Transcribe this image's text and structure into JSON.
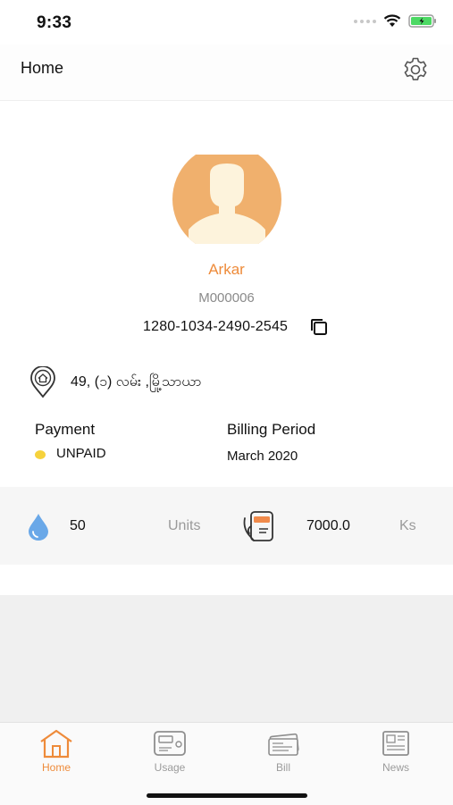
{
  "status_bar": {
    "time": "9:33"
  },
  "header": {
    "title": "Home",
    "settings_icon": "gear-icon"
  },
  "profile": {
    "name": "Arkar",
    "member_id": "M000006",
    "account_number": "1280-1034-2490-2545",
    "avatar_icon": "user-avatar-icon",
    "copy_icon": "copy-icon"
  },
  "address": {
    "icon": "home-location-pin-icon",
    "text": "49, (၁) လမ်း ,မြို့သာယာ"
  },
  "payment": {
    "label": "Payment",
    "status": "UNPAID",
    "status_color": "#f6d23c"
  },
  "billing": {
    "label": "Billing Period",
    "period": "March 2020"
  },
  "usage": {
    "units_value": "50",
    "units_label": "Units",
    "amount_value": "7000.0",
    "currency_label": "Ks"
  },
  "tabs": [
    {
      "label": "Home",
      "icon": "house-icon",
      "active": true
    },
    {
      "label": "Usage",
      "icon": "meter-icon",
      "active": false
    },
    {
      "label": "Bill",
      "icon": "bill-icon",
      "active": false
    },
    {
      "label": "News",
      "icon": "newspaper-icon",
      "active": false
    }
  ],
  "colors": {
    "accent": "#ee8b3a",
    "avatar_bg": "#f0b06d",
    "water_drop": "#6aa8e8"
  }
}
